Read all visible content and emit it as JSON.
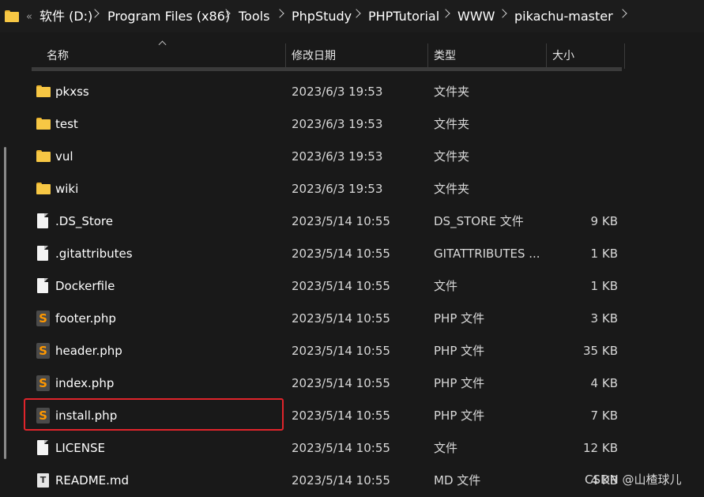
{
  "breadcrumb": {
    "overflow": "«",
    "items": [
      "软件 (D:)",
      "Program Files (x86)",
      "Tools",
      "PhpStudy",
      "PHPTutorial",
      "WWW",
      "pikachu-master"
    ]
  },
  "columns": {
    "name": "名称",
    "date": "修改日期",
    "type": "类型",
    "size": "大小"
  },
  "files": [
    {
      "name": "pkxss",
      "date": "2023/6/3 19:53",
      "type": "文件夹",
      "size": "",
      "icon": "folder"
    },
    {
      "name": "test",
      "date": "2023/6/3 19:53",
      "type": "文件夹",
      "size": "",
      "icon": "folder"
    },
    {
      "name": "vul",
      "date": "2023/6/3 19:53",
      "type": "文件夹",
      "size": "",
      "icon": "folder"
    },
    {
      "name": "wiki",
      "date": "2023/6/3 19:53",
      "type": "文件夹",
      "size": "",
      "icon": "folder"
    },
    {
      "name": ".DS_Store",
      "date": "2023/5/14 10:55",
      "type": "DS_STORE 文件",
      "size": "9 KB",
      "icon": "doc"
    },
    {
      "name": ".gitattributes",
      "date": "2023/5/14 10:55",
      "type": "GITATTRIBUTES ...",
      "size": "1 KB",
      "icon": "doc"
    },
    {
      "name": "Dockerfile",
      "date": "2023/5/14 10:55",
      "type": "文件",
      "size": "1 KB",
      "icon": "doc"
    },
    {
      "name": "footer.php",
      "date": "2023/5/14 10:55",
      "type": "PHP 文件",
      "size": "3 KB",
      "icon": "sublime"
    },
    {
      "name": "header.php",
      "date": "2023/5/14 10:55",
      "type": "PHP 文件",
      "size": "35 KB",
      "icon": "sublime"
    },
    {
      "name": "index.php",
      "date": "2023/5/14 10:55",
      "type": "PHP 文件",
      "size": "4 KB",
      "icon": "sublime"
    },
    {
      "name": "install.php",
      "date": "2023/5/14 10:55",
      "type": "PHP 文件",
      "size": "7 KB",
      "icon": "sublime"
    },
    {
      "name": "LICENSE",
      "date": "2023/5/14 10:55",
      "type": "文件",
      "size": "12 KB",
      "icon": "doc"
    },
    {
      "name": "README.md",
      "date": "2023/5/14 10:55",
      "type": "MD 文件",
      "size": "4 KB",
      "icon": "readme"
    }
  ],
  "watermark": "CSDN @山楂球儿",
  "colors": {
    "highlight": "#e0242b",
    "folder": "#f7c744",
    "sublime": "#ff9800"
  }
}
